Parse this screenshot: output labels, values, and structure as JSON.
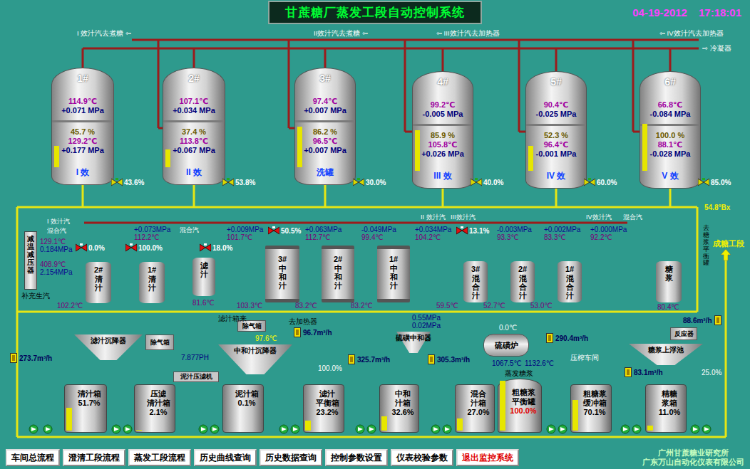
{
  "header": {
    "title": "甘蔗糖厂蒸发工段自动控制系统",
    "date": "04-19-2012",
    "time": "17:18:01"
  },
  "vapor_outlets": [
    "I 效汁汽去煮糖 ⇦",
    "II效汁汽去煮糖 ⇦",
    "⇦ III效汁汽去加热器",
    "⇦ IV效汁汽去加热器",
    "⇨ 冷凝器"
  ],
  "evaporators": [
    {
      "name": "1#",
      "top_temp": "114.9℃",
      "top_pressure": "+0.071 MPa",
      "level_text": "45.7 %",
      "level": 0.457,
      "heater_temp": "129.2℃",
      "heater_pressure": "+0.177 MPa",
      "label": "I 效",
      "valve": "43.6%"
    },
    {
      "name": "2#",
      "top_temp": "107.1℃",
      "top_pressure": "+0.034 MPa",
      "level_text": "37.4 %",
      "level": 0.374,
      "heater_temp": "113.8℃",
      "heater_pressure": "+0.067 MPa",
      "label": "II 效",
      "valve": "53.8%"
    },
    {
      "name": "3#",
      "top_temp": "97.4℃",
      "top_pressure": "+0.007 MPa",
      "level_text": "86.2 %",
      "level": 0.862,
      "heater_temp": "96.5℃",
      "heater_pressure": "+0.007 MPa",
      "label": "洗罐",
      "valve": "30.0%"
    },
    {
      "name": "4#",
      "top_temp": "99.2℃",
      "top_pressure": "-0.005 MPa",
      "level_text": "85.9 %",
      "level": 0.859,
      "heater_temp": "105.8℃",
      "heater_pressure": "+0.026 MPa",
      "label": "III 效",
      "valve": "40.0%"
    },
    {
      "name": "5#",
      "top_temp": "90.4℃",
      "top_pressure": "-0.025 MPa",
      "level_text": "52.3 %",
      "level": 0.523,
      "heater_temp": "96.4℃",
      "heater_pressure": "-0.001 MPa",
      "label": "IV 效",
      "valve": "60.0%"
    },
    {
      "name": "6#",
      "top_temp": "66.8℃",
      "top_pressure": "-0.084 MPa",
      "level_text": "100.0 %",
      "level": 1.0,
      "heater_temp": "88.1℃",
      "heater_pressure": "-0.028 MPa",
      "label": "V 效",
      "valve": "85.0%"
    }
  ],
  "steam_labels": [
    "I 效汁汽",
    "混合汽",
    "混合汽",
    "II 效汁汽",
    "III效汁汽",
    "IV效汁汽",
    "混合汽"
  ],
  "steam_valves": [
    "0.0%",
    "100.0%",
    "18.0%",
    "50.5%",
    "13.1%"
  ],
  "line_readings": [
    {
      "pressure": "+0.073MPa",
      "temp": "112.2℃"
    },
    {
      "pressure": "+0.009MPa",
      "temp": "101.7℃"
    },
    {
      "pressure": "+0.063MPa",
      "temp": "112.7℃"
    },
    {
      "pressure": "-0.049MPa",
      "temp": "99.4℃"
    },
    {
      "pressure": "+0.034MPa",
      "temp": "104.2℃"
    },
    {
      "pressure": "-0.003MPa",
      "temp": "93.3℃"
    },
    {
      "pressure": "+0.002MPa",
      "temp": "83.3℃"
    },
    {
      "pressure": "+0.000MPa",
      "temp": "92.2℃"
    }
  ],
  "desuperheater": {
    "label": "减温减压器",
    "readings": [
      "129.1℃",
      "0.184MPa",
      "408.9℃",
      "2.154MPa"
    ],
    "supply": "补充生汽"
  },
  "process_tanks": [
    {
      "num": "2#",
      "label": "清汁",
      "temp": "102.2℃",
      "kind": "juice"
    },
    {
      "num": "1#",
      "label": "清汁",
      "kind": "juice"
    },
    {
      "label": "滤汁",
      "temp": "81.6℃",
      "kind": "juice"
    },
    {
      "num": "3#",
      "label": "中和汁",
      "temp": "103.3℃",
      "kind": "column"
    },
    {
      "num": "2#",
      "label": "中和汁",
      "temp": "83.2℃",
      "kind": "column"
    },
    {
      "num": "1#",
      "label": "中和汁",
      "temp": "83.2℃",
      "kind": "column"
    },
    {
      "num": "3#",
      "label": "混合汁",
      "temp": "59.5℃",
      "kind": "juice"
    },
    {
      "num": "2#",
      "label": "混合汁",
      "temp": "52.7℃",
      "kind": "juice"
    },
    {
      "num": "1#",
      "label": "混合汁",
      "temp": "53.0℃",
      "kind": "juice"
    },
    {
      "label": "糖浆",
      "temp": "80.4℃",
      "kind": "juice"
    }
  ],
  "syrup": {
    "brix": "54.8°Bx",
    "to_tank": "去糖浆平衡罐",
    "to_section": "成糖工段"
  },
  "equipment": [
    {
      "label": "滤汁沉降器",
      "kind": "settler"
    },
    {
      "label": "除气箱",
      "kind": "box"
    },
    {
      "label": "除气箱",
      "kind": "box"
    },
    {
      "label": "中和汁沉降器",
      "kind": "settler"
    },
    {
      "label": "硫磺中和器",
      "kind": "settler"
    },
    {
      "label": "硫磺炉",
      "kind": "furnace"
    },
    {
      "label": "反应器",
      "kind": "box"
    },
    {
      "label": "糖浆上浮池",
      "kind": "settler"
    },
    {
      "label": "泥汁压滤机",
      "kind": "plate"
    }
  ],
  "flows": [
    "273.7m³/h",
    "96.7m³/h",
    "325.7m³/h",
    "305.3m³/h",
    "290.4m³/h",
    "88.6m³/h",
    "83.1m³/h"
  ],
  "annotations": [
    {
      "text": "滤汁箱来",
      "color": "#000000"
    },
    {
      "text": "去加热器",
      "color": "#000000"
    },
    {
      "text": "0.55MPa",
      "color": "#000080"
    },
    {
      "text": "0.02MPa",
      "color": "#000080"
    },
    {
      "text": "0.0℃",
      "color": "#ffffff"
    },
    {
      "text": "1067.5℃",
      "color": "#000080"
    },
    {
      "text": "1132.6℃",
      "color": "#000080"
    },
    {
      "text": "蒸发糖浆",
      "color": "#000000"
    },
    {
      "text": "7.877PH",
      "color": "#000080"
    },
    {
      "text": "97.6℃",
      "color": "#ffff00"
    },
    {
      "text": "压榨车间",
      "color": "#ffffff"
    },
    {
      "text": "100.0%",
      "color": "#ffffff"
    },
    {
      "text": "25.0%",
      "color": "#ffffff"
    }
  ],
  "storage_tanks": [
    {
      "label": "清汁箱",
      "reading": "51.7%",
      "level": 0.517,
      "alarm": false,
      "kind": "box"
    },
    {
      "label": "压滤\n清汁箱",
      "reading": "2.1%",
      "level": 0.021,
      "alarm": false,
      "kind": "box"
    },
    {
      "label": "泥汁箱",
      "reading": "0.1%",
      "level": 0.001,
      "alarm": false,
      "kind": "box"
    },
    {
      "label": "滤汁\n平衡箱",
      "reading": "23.2%",
      "level": 0.232,
      "alarm": false,
      "kind": "box"
    },
    {
      "label": "中和\n汁箱",
      "reading": "32.6%",
      "level": 0.326,
      "alarm": false,
      "kind": "box"
    },
    {
      "label": "混合\n汁箱",
      "reading": "27.0%",
      "level": 0.27,
      "alarm": false,
      "kind": "box"
    },
    {
      "label": "粗糖浆\n平衡罐",
      "reading": "100.0%",
      "level": 1.0,
      "alarm": true,
      "kind": "drum"
    },
    {
      "label": "粗糖浆\n缓冲箱",
      "reading": "70.1%",
      "level": 0.701,
      "alarm": false,
      "kind": "box"
    },
    {
      "label": "精糖\n浆箱",
      "reading": "11.0%",
      "level": 0.11,
      "alarm": false,
      "kind": "box"
    }
  ],
  "nav_buttons": [
    {
      "label": "车间总流程",
      "kind": "normal"
    },
    {
      "label": "澄清工段流程",
      "kind": "normal"
    },
    {
      "label": "蒸发工段流程",
      "kind": "normal"
    },
    {
      "label": "历史曲线查询",
      "kind": "normal"
    },
    {
      "label": "历史数据查询",
      "kind": "normal"
    },
    {
      "label": "控制参数设置",
      "kind": "normal"
    },
    {
      "label": "仪表校验参数",
      "kind": "normal"
    },
    {
      "label": "退出监控系统",
      "kind": "exit"
    }
  ],
  "credits": [
    "广州甘蔗糖业研究所",
    "广东万山自动化仪表有限公司"
  ]
}
